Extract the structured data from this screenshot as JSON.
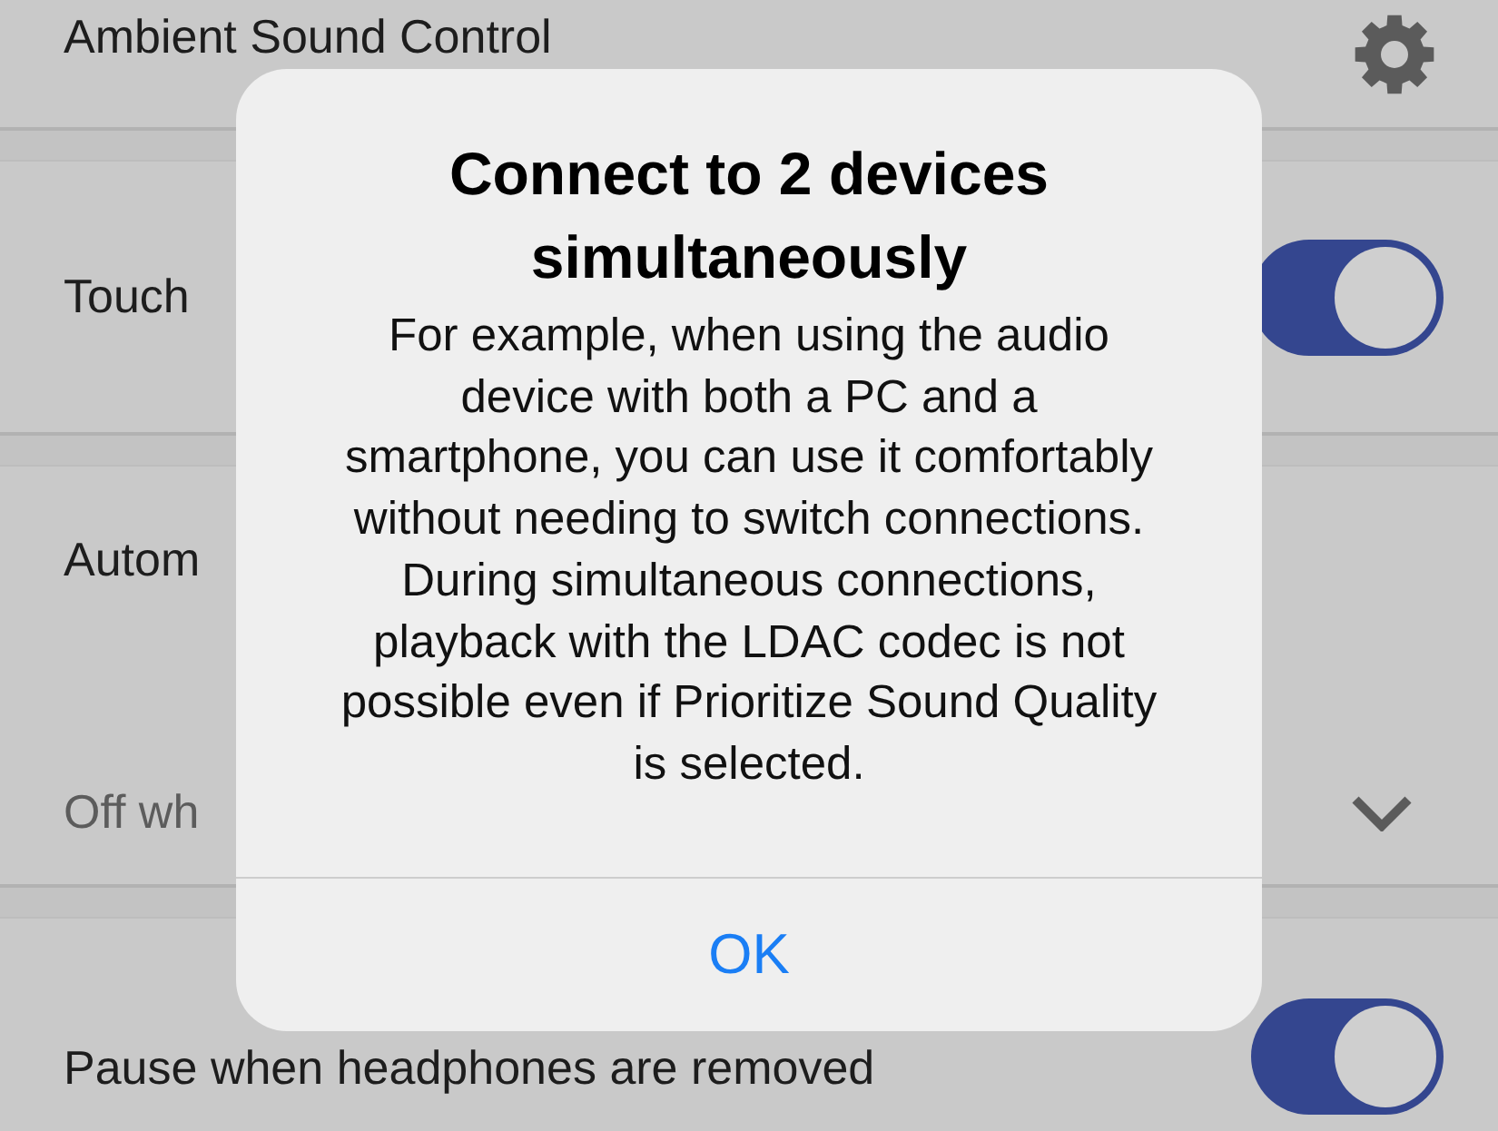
{
  "settings": [
    {
      "kind": "link",
      "label": "Ambient Sound Control"
    },
    {
      "kind": "toggle",
      "label": "Touch",
      "on": true
    },
    {
      "kind": "dropdown",
      "label": "Autom",
      "value": "Off wh"
    },
    {
      "kind": "toggle",
      "label": "Pause when headphones are removed",
      "on": true
    }
  ],
  "dialog": {
    "title": "Connect to 2 devices simultaneously",
    "message": "For example, when using the audio device with both a PC and a smartphone, you can use it comfortably without needing to switch connections. During simultaneous connections, playback with the LDAC codec is not possible even if Prioritize Sound Quality is selected.",
    "buttons": [
      "OK"
    ]
  }
}
